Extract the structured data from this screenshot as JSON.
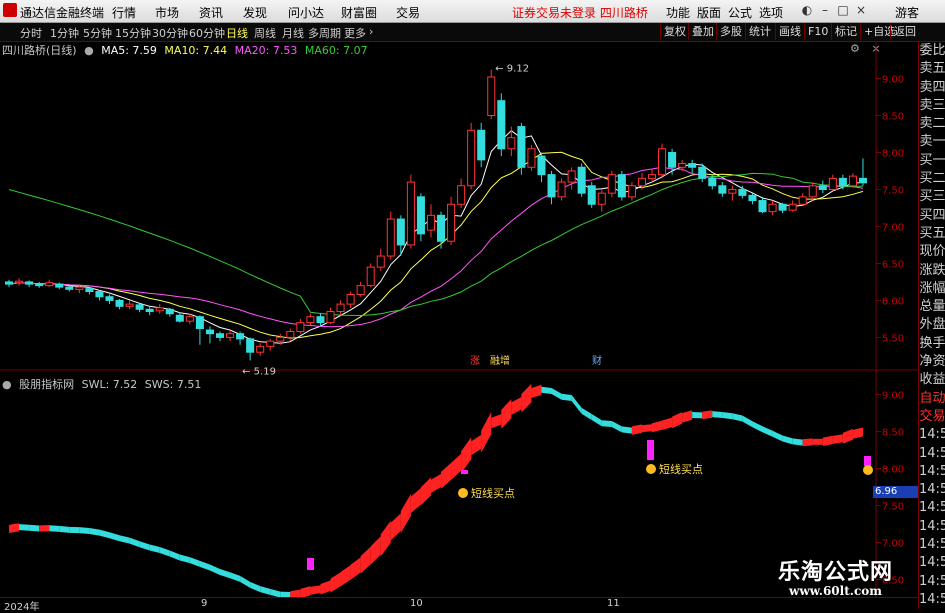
{
  "app": {
    "title": "通达信金融终端"
  },
  "menu": [
    "行情",
    "市场",
    "资讯",
    "发现",
    "问小达",
    "财富圈",
    "交易"
  ],
  "warning": "证券交易未登录  四川路桥",
  "top_right": [
    "功能",
    "版面",
    "公式",
    "选项",
    "游客"
  ],
  "periods": [
    "分时",
    "1分钟",
    "5分钟",
    "15分钟",
    "30分钟",
    "60分钟",
    "日线",
    "周线",
    "月线",
    "多周期",
    "更多"
  ],
  "active_period": "日线",
  "tool_buttons": [
    "复权",
    "叠加",
    "多股",
    "统计",
    "画线",
    "F10",
    "标记",
    "+自选",
    "返回"
  ],
  "main": {
    "stock_label": "四川路桥(日线)",
    "ma": [
      {
        "label": "MA5: 7.59",
        "color": "#ffffff"
      },
      {
        "label": "MA10: 7.44",
        "color": "#ffff55"
      },
      {
        "label": "MA20: 7.53",
        "color": "#ff55ff"
      },
      {
        "label": "MA60: 7.07",
        "color": "#33cc33"
      }
    ],
    "price_high": "9.12",
    "price_low": "5.19",
    "markers": [
      {
        "text": "涨",
        "color": "#ff3333"
      },
      {
        "text": "融增",
        "color": "#ffdd55"
      },
      {
        "text": "财",
        "color": "#66aaff"
      }
    ]
  },
  "sub": {
    "title": "股朋指标网",
    "lines": [
      {
        "label": "SWL: 7.52",
        "color": "#d0d0d0"
      },
      {
        "label": "SWS: 7.51",
        "color": "#d0d0d0"
      }
    ],
    "buy_label": "短线买点",
    "current_value": "6.96"
  },
  "side": [
    "委比",
    "卖五",
    "卖四",
    "卖三",
    "卖二",
    "卖一",
    "买一",
    "买二",
    "买三",
    "买四",
    "买五",
    "现价",
    "涨跌",
    "涨幅",
    "总量",
    "外盘",
    "换手",
    "净资",
    "收益",
    "自动",
    "交易",
    "14:56",
    "14:56",
    "14:56",
    "14:56",
    "14:56",
    "14:56",
    "14:56",
    "14:56",
    "14:56",
    "14:56"
  ],
  "time_axis": [
    "2024年",
    "9",
    "10",
    "11"
  ],
  "watermark": {
    "line1": "乐淘公式网",
    "line2": "www.60lt.com"
  },
  "colors": {
    "up": "#ff3333",
    "down": "#33dddd",
    "ma5": "#ffffff",
    "ma10": "#ffff55",
    "ma20": "#ff55ff",
    "ma60": "#33cc33",
    "grid": "#7a0000"
  },
  "chart_data": {
    "type": "candlestick",
    "y_ticks_main": [
      "9.00",
      "8.50",
      "8.00",
      "7.50",
      "7.00",
      "6.50",
      "6.00",
      "5.50"
    ],
    "y_ticks_sub": [
      "9.00",
      "8.50",
      "8.00",
      "7.50",
      "7.00",
      "6.50"
    ],
    "candles": [
      {
        "o": 6.25,
        "c": 6.22,
        "h": 6.28,
        "l": 6.18
      },
      {
        "o": 6.24,
        "c": 6.26,
        "h": 6.3,
        "l": 6.2
      },
      {
        "o": 6.25,
        "c": 6.22,
        "h": 6.27,
        "l": 6.18
      },
      {
        "o": 6.22,
        "c": 6.2,
        "h": 6.25,
        "l": 6.17
      },
      {
        "o": 6.2,
        "c": 6.24,
        "h": 6.28,
        "l": 6.18
      },
      {
        "o": 6.22,
        "c": 6.18,
        "h": 6.24,
        "l": 6.15
      },
      {
        "o": 6.18,
        "c": 6.15,
        "h": 6.22,
        "l": 6.12
      },
      {
        "o": 6.15,
        "c": 6.18,
        "h": 6.2,
        "l": 6.1
      },
      {
        "o": 6.16,
        "c": 6.12,
        "h": 6.18,
        "l": 6.08
      },
      {
        "o": 6.12,
        "c": 6.05,
        "h": 6.14,
        "l": 6.0
      },
      {
        "o": 6.05,
        "c": 6.0,
        "h": 6.08,
        "l": 5.95
      },
      {
        "o": 6.0,
        "c": 5.92,
        "h": 6.02,
        "l": 5.88
      },
      {
        "o": 5.92,
        "c": 5.95,
        "h": 6.0,
        "l": 5.88
      },
      {
        "o": 5.94,
        "c": 5.88,
        "h": 5.97,
        "l": 5.84
      },
      {
        "o": 5.88,
        "c": 5.85,
        "h": 5.92,
        "l": 5.8
      },
      {
        "o": 5.86,
        "c": 5.9,
        "h": 5.95,
        "l": 5.82
      },
      {
        "o": 5.88,
        "c": 5.82,
        "h": 5.9,
        "l": 5.78
      },
      {
        "o": 5.8,
        "c": 5.72,
        "h": 5.84,
        "l": 5.7
      },
      {
        "o": 5.72,
        "c": 5.78,
        "h": 5.82,
        "l": 5.68
      },
      {
        "o": 5.78,
        "c": 5.62,
        "h": 5.8,
        "l": 5.4
      },
      {
        "o": 5.6,
        "c": 5.55,
        "h": 5.65,
        "l": 5.42
      },
      {
        "o": 5.55,
        "c": 5.5,
        "h": 5.58,
        "l": 5.45
      },
      {
        "o": 5.5,
        "c": 5.55,
        "h": 5.6,
        "l": 5.45
      },
      {
        "o": 5.55,
        "c": 5.48,
        "h": 5.58,
        "l": 5.4
      },
      {
        "o": 5.48,
        "c": 5.3,
        "h": 5.5,
        "l": 5.19
      },
      {
        "o": 5.3,
        "c": 5.38,
        "h": 5.42,
        "l": 5.25
      },
      {
        "o": 5.38,
        "c": 5.45,
        "h": 5.48,
        "l": 5.32
      },
      {
        "o": 5.45,
        "c": 5.5,
        "h": 5.55,
        "l": 5.4
      },
      {
        "o": 5.5,
        "c": 5.58,
        "h": 5.62,
        "l": 5.45
      },
      {
        "o": 5.58,
        "c": 5.7,
        "h": 5.75,
        "l": 5.55
      },
      {
        "o": 5.7,
        "c": 5.78,
        "h": 5.82,
        "l": 5.65
      },
      {
        "o": 5.78,
        "c": 5.7,
        "h": 5.82,
        "l": 5.65
      },
      {
        "o": 5.7,
        "c": 5.85,
        "h": 5.9,
        "l": 5.68
      },
      {
        "o": 5.85,
        "c": 5.95,
        "h": 6.0,
        "l": 5.8
      },
      {
        "o": 5.95,
        "c": 6.08,
        "h": 6.12,
        "l": 5.9
      },
      {
        "o": 6.08,
        "c": 6.2,
        "h": 6.25,
        "l": 6.05
      },
      {
        "o": 6.2,
        "c": 6.45,
        "h": 6.5,
        "l": 6.18
      },
      {
        "o": 6.45,
        "c": 6.6,
        "h": 6.7,
        "l": 6.4
      },
      {
        "o": 6.6,
        "c": 7.1,
        "h": 7.2,
        "l": 6.55
      },
      {
        "o": 7.1,
        "c": 6.75,
        "h": 7.15,
        "l": 6.6
      },
      {
        "o": 6.75,
        "c": 7.6,
        "h": 7.7,
        "l": 6.7
      },
      {
        "o": 7.4,
        "c": 6.9,
        "h": 7.45,
        "l": 6.8
      },
      {
        "o": 6.95,
        "c": 7.15,
        "h": 7.3,
        "l": 6.85
      },
      {
        "o": 7.15,
        "c": 6.8,
        "h": 7.2,
        "l": 6.7
      },
      {
        "o": 6.8,
        "c": 7.3,
        "h": 7.4,
        "l": 6.75
      },
      {
        "o": 7.3,
        "c": 7.55,
        "h": 7.65,
        "l": 7.25
      },
      {
        "o": 7.55,
        "c": 8.3,
        "h": 8.4,
        "l": 7.5
      },
      {
        "o": 8.3,
        "c": 7.9,
        "h": 8.4,
        "l": 7.8
      },
      {
        "o": 8.5,
        "c": 9.02,
        "h": 9.12,
        "l": 8.45
      },
      {
        "o": 8.7,
        "c": 8.05,
        "h": 8.8,
        "l": 7.95
      },
      {
        "o": 8.05,
        "c": 8.2,
        "h": 8.35,
        "l": 7.95
      },
      {
        "o": 8.35,
        "c": 7.8,
        "h": 8.4,
        "l": 7.7
      },
      {
        "o": 7.8,
        "c": 8.05,
        "h": 8.1,
        "l": 7.75
      },
      {
        "o": 7.95,
        "c": 7.7,
        "h": 8.0,
        "l": 7.6
      },
      {
        "o": 7.7,
        "c": 7.4,
        "h": 7.75,
        "l": 7.3
      },
      {
        "o": 7.4,
        "c": 7.6,
        "h": 7.65,
        "l": 7.35
      },
      {
        "o": 7.6,
        "c": 7.75,
        "h": 7.8,
        "l": 7.5
      },
      {
        "o": 7.8,
        "c": 7.45,
        "h": 7.85,
        "l": 7.4
      },
      {
        "o": 7.55,
        "c": 7.3,
        "h": 7.6,
        "l": 7.25
      },
      {
        "o": 7.3,
        "c": 7.45,
        "h": 7.5,
        "l": 7.2
      },
      {
        "o": 7.45,
        "c": 7.7,
        "h": 7.75,
        "l": 7.4
      },
      {
        "o": 7.7,
        "c": 7.4,
        "h": 7.75,
        "l": 7.35
      },
      {
        "o": 7.4,
        "c": 7.55,
        "h": 7.6,
        "l": 7.35
      },
      {
        "o": 7.55,
        "c": 7.65,
        "h": 7.72,
        "l": 7.5
      },
      {
        "o": 7.65,
        "c": 7.7,
        "h": 7.78,
        "l": 7.6
      },
      {
        "o": 7.7,
        "c": 8.05,
        "h": 8.12,
        "l": 7.65
      },
      {
        "o": 8.0,
        "c": 7.8,
        "h": 8.05,
        "l": 7.7
      },
      {
        "o": 7.8,
        "c": 7.85,
        "h": 7.9,
        "l": 7.75
      },
      {
        "o": 7.85,
        "c": 7.8,
        "h": 7.9,
        "l": 7.72
      },
      {
        "o": 7.8,
        "c": 7.65,
        "h": 7.85,
        "l": 7.6
      },
      {
        "o": 7.65,
        "c": 7.55,
        "h": 7.7,
        "l": 7.5
      },
      {
        "o": 7.55,
        "c": 7.45,
        "h": 7.6,
        "l": 7.4
      },
      {
        "o": 7.45,
        "c": 7.5,
        "h": 7.55,
        "l": 7.35
      },
      {
        "o": 7.5,
        "c": 7.42,
        "h": 7.55,
        "l": 7.38
      },
      {
        "o": 7.42,
        "c": 7.35,
        "h": 7.45,
        "l": 7.3
      },
      {
        "o": 7.35,
        "c": 7.2,
        "h": 7.4,
        "l": 7.18
      },
      {
        "o": 7.2,
        "c": 7.3,
        "h": 7.35,
        "l": 7.15
      },
      {
        "o": 7.3,
        "c": 7.22,
        "h": 7.32,
        "l": 7.18
      },
      {
        "o": 7.22,
        "c": 7.3,
        "h": 7.35,
        "l": 7.2
      },
      {
        "o": 7.3,
        "c": 7.4,
        "h": 7.45,
        "l": 7.28
      },
      {
        "o": 7.4,
        "c": 7.55,
        "h": 7.6,
        "l": 7.35
      },
      {
        "o": 7.55,
        "c": 7.5,
        "h": 7.62,
        "l": 7.45
      },
      {
        "o": 7.5,
        "c": 7.65,
        "h": 7.7,
        "l": 7.48
      },
      {
        "o": 7.65,
        "c": 7.55,
        "h": 7.7,
        "l": 7.5
      },
      {
        "o": 7.55,
        "c": 7.68,
        "h": 7.72,
        "l": 7.52
      },
      {
        "o": 7.65,
        "c": 7.59,
        "h": 7.92,
        "l": 7.55
      }
    ]
  }
}
